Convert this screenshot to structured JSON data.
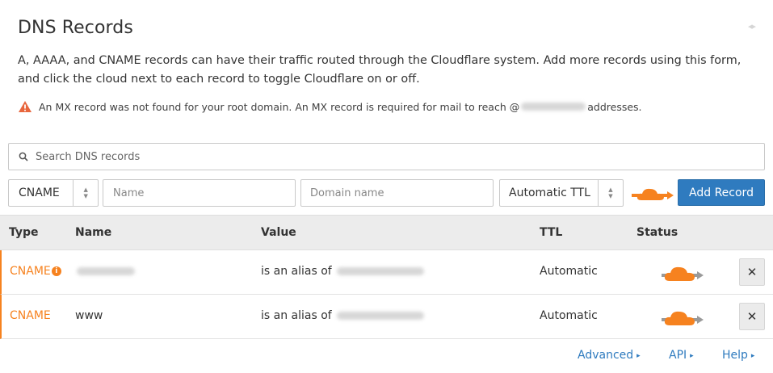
{
  "page": {
    "title": "DNS Records",
    "description": "A, AAAA, and CNAME records can have their traffic routed through the Cloudflare system. Add more records using this form, and click the cloud next to each record to toggle Cloudflare on or off.",
    "warning_before": "An MX record was not found for your root domain. An MX record is required for mail to reach @",
    "warning_after": " addresses."
  },
  "search": {
    "placeholder": "Search DNS records"
  },
  "form": {
    "type_value": "CNAME",
    "name_placeholder": "Name",
    "domain_placeholder": "Domain name",
    "ttl_value": "Automatic TTL",
    "add_label": "Add Record"
  },
  "table": {
    "headers": {
      "type": "Type",
      "name": "Name",
      "value": "Value",
      "ttl": "TTL",
      "status": "Status"
    },
    "rows": [
      {
        "type": "CNAME",
        "name": "",
        "value_prefix": "is an alias of ",
        "ttl": "Automatic",
        "delete": "✕"
      },
      {
        "type": "CNAME",
        "name": "www",
        "value_prefix": "is an alias of ",
        "ttl": "Automatic",
        "delete": "✕"
      }
    ]
  },
  "footer": {
    "advanced": "Advanced",
    "api": "API",
    "help": "Help",
    "arrow": "▸"
  },
  "colors": {
    "accent": "#f6821f",
    "button": "#2f7bbf",
    "header_bg": "#ececec"
  }
}
